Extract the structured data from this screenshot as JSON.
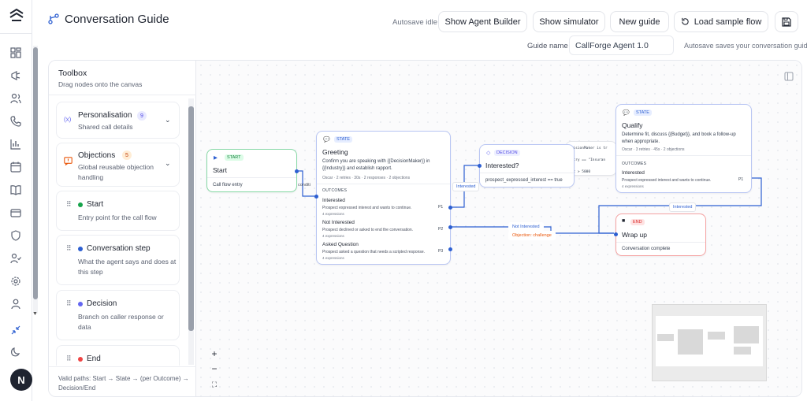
{
  "app": {
    "title": "Conversation Guide",
    "autosave_status": "Autosave idle"
  },
  "header_buttons": {
    "agent_builder": "Show Agent Builder",
    "simulator": "Show simulator",
    "new_guide": "New guide",
    "load_sample": "Load sample flow"
  },
  "guide": {
    "name_label": "Guide name",
    "name_value": "CallForge Agent 1.0",
    "autosave_hint": "Autosave saves your conversation guide"
  },
  "rail": {
    "icons": [
      "dashboard-icon",
      "megaphone-icon",
      "users-icon",
      "phone-icon",
      "chart-icon",
      "calendar-icon",
      "book-icon",
      "card-icon",
      "shield-icon",
      "user-check-icon",
      "settings-icon",
      "user-icon"
    ],
    "bottom_icons": [
      "collapse-icon",
      "moon-icon"
    ],
    "avatar_initial": "N"
  },
  "toolbox": {
    "title": "Toolbox",
    "subtitle": "Drag nodes onto the canvas",
    "groups": [
      {
        "title": "Personalisation",
        "count": "9",
        "desc": "Shared call details"
      },
      {
        "title": "Objections",
        "count": "5",
        "desc": "Global reusable objection handling"
      }
    ],
    "items": [
      {
        "title": "Start",
        "desc": "Entry point for the call flow",
        "color": "#16a34a"
      },
      {
        "title": "Conversation step",
        "desc": "What the agent says and does at this step",
        "color": "#2d5fd1"
      },
      {
        "title": "Decision",
        "desc": "Branch on caller response or data",
        "color": "#6366f1"
      },
      {
        "title": "End",
        "desc": "",
        "color": "#ef4444"
      }
    ],
    "valid_paths": "Valid paths: Start → State → (per Outcome) → Decision/End"
  },
  "canvas": {
    "nodes": {
      "start": {
        "tag": "START",
        "title": "Start",
        "body": "Call flow entry",
        "color": "#16a34a"
      },
      "greeting": {
        "tag": "STATE",
        "title": "Greeting",
        "body": "Confirm you are speaking with {{DecisionMaker}} in {{Industry}} and establish rapport.",
        "meta": "Oscar · 2 retries · 30s · 2 responses · 2 objections",
        "outcomes_label": "OUTCOMES",
        "outcomes": [
          {
            "name": "Interested",
            "desc": "Prospect expressed interest and wants to continue.",
            "exp": "4 expressions",
            "pri": "P1"
          },
          {
            "name": "Not Interested",
            "desc": "Prospect declined or asked to end the conversation.",
            "exp": "4 expressions",
            "pri": "P2"
          },
          {
            "name": "Asked Question",
            "desc": "Prospect asked a question that needs a scripted response.",
            "exp": "4 expressions",
            "pri": "P3"
          }
        ]
      },
      "decision": {
        "tag": "DECISION",
        "title": "Interested?",
        "body": "prospect_expressed_interest == true"
      },
      "hidden_decision": {
        "line1": "ecisionMaker is tr",
        "line2": "ustry == \"Insuran",
        "line3": "get > 5000"
      },
      "qualify": {
        "tag": "STATE",
        "title": "Qualify",
        "body": "Determine fit, discuss {{Budget}}, and book a follow-up when appropriate.",
        "meta": "Oscar · 3 retries · 45s · 2 objections",
        "outcomes_label": "OUTCOMES",
        "outcome": {
          "name": "Interested",
          "desc": "Prospect expressed interest and wants to continue.",
          "exp": "4 expressions",
          "pri": "P1"
        }
      },
      "wrapup": {
        "tag": "END",
        "title": "Wrap up",
        "body": "Conversation complete"
      }
    },
    "edge_labels": {
      "start_greeting": "conditi",
      "interested": "Interested",
      "not_interested": "Not Interested",
      "objection": "Objection: challenge",
      "qualify_interested": "Interested"
    },
    "controls": {
      "zoom_in": "+",
      "zoom_out": "−",
      "fit": "⛶"
    }
  },
  "colors": {
    "accent": "#2d5fd1",
    "start": "#16a34a",
    "end": "#ef4444",
    "decision": "#6366f1"
  }
}
